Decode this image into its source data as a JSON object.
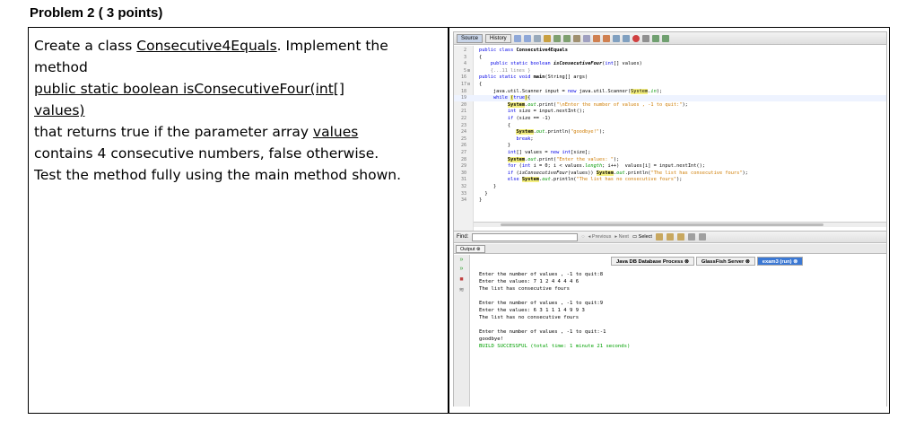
{
  "problem": {
    "title": "Problem 2 ( 3 points)",
    "line1_a": "Create a class ",
    "line1_class": "Consecutive4Equals",
    "line1_b": ". Implement the",
    "line2": "method",
    "line3": " public static boolean isConsecutiveFour(int[]",
    "line4": "values)",
    "line5_a": "that returns true if the parameter array ",
    "line5_b": "values",
    "line6": "contains 4 consecutive numbers, false otherwise.",
    "line7": "Test the method fully using the main method shown."
  },
  "ide": {
    "tabs": [
      "Source",
      "History"
    ],
    "find_label": "Find:",
    "find_previous": "Previous",
    "find_next": "Next",
    "find_select": "Select",
    "output_tab": "Output",
    "process_tabs": [
      "Java DB Database Process",
      "GlassFish Server",
      "exam3 (run)"
    ],
    "code_lines": [
      {
        "n": "2",
        "fold": "",
        "html": "<span class='kw'>public class</span> <span class='cls'>Consecutive4Equals</span>"
      },
      {
        "n": "3",
        "fold": "",
        "html": "{"
      },
      {
        "n": "4",
        "fold": "",
        "html": "    <span class='kw'>public static boolean</span> <span class='bold' style='font-style:italic'>isConsecutiveFour</span>(<span class='kw'>int</span>[] values)"
      },
      {
        "n": "5",
        "fold": "⊞",
        "html": "    <span class='cm'>{...11 lines }</span>"
      },
      {
        "n": "16",
        "fold": "",
        "html": "<span class='kw'>public static void</span> <span class='bold'>main</span>(String[] args)"
      },
      {
        "n": "17",
        "fold": "⊟",
        "html": "{"
      },
      {
        "n": "18",
        "fold": "",
        "html": "     java.util.Scanner input = <span class='kw'>new</span> java.util.Scanner(<span class='hl'>System</span>.<span class='fld'>in</span>);"
      },
      {
        "n": "19",
        "fold": "",
        "html": "     <span class='kw'>while</span> <span class='hl'>(</span><span class='kw'>true</span><span class='hl'>)</span>{",
        "row": true
      },
      {
        "n": "20",
        "fold": "",
        "html": "          <span class='hl bold'>System</span>.<span class='fld'>out</span>.print(<span class='str'>\"\\nEnter the number of values , -1 to quit:\"</span>);"
      },
      {
        "n": "21",
        "fold": "",
        "html": "          <span class='kw'>int</span> size = input.nextInt();"
      },
      {
        "n": "22",
        "fold": "",
        "html": "          <span class='kw'>if</span> (size == -1)"
      },
      {
        "n": "23",
        "fold": "",
        "html": "          {"
      },
      {
        "n": "24",
        "fold": "",
        "html": "             <span class='hl bold'>System</span>.<span class='fld'>out</span>.println(<span class='str'>\"goodbye!\"</span>);"
      },
      {
        "n": "25",
        "fold": "",
        "html": "             <span class='kw'>break</span>;"
      },
      {
        "n": "26",
        "fold": "",
        "html": "          }"
      },
      {
        "n": "27",
        "fold": "",
        "html": "          <span class='kw'>int</span>[] values = <span class='kw'>new int</span>[size];"
      },
      {
        "n": "28",
        "fold": "",
        "html": "          <span class='hl bold'>System</span>.<span class='fld'>out</span>.print(<span class='str'>\"Enter the values: \"</span>);"
      },
      {
        "n": "29",
        "fold": "",
        "html": "          <span class='kw'>for</span> (<span class='kw'>int</span> i = 0; i &lt; values.<span class='fld'>length</span>; i++)  values[i] = input.nextInt();"
      },
      {
        "n": "30",
        "fold": "",
        "html": "          <span class='kw'>if</span> (<span style='font-style:italic'>isConsecutiveFour</span>(values)) <span class='hl bold'>System</span>.<span class='fld'>out</span>.println(<span class='str'>\"The list has consecutive fours\"</span>);"
      },
      {
        "n": "31",
        "fold": "",
        "html": "          <span class='kw'>else</span> <span class='hl bold'>System</span>.<span class='fld'>out</span>.println(<span class='str'>\"The list has no consecutive fours\"</span>);"
      },
      {
        "n": "32",
        "fold": "",
        "html": "     }"
      },
      {
        "n": "33",
        "fold": "",
        "html": "  }"
      },
      {
        "n": "34",
        "fold": "",
        "html": "}"
      }
    ],
    "output_lines": [
      {
        "text": "Enter the number of values , -1 to quit:8",
        "success": false
      },
      {
        "text": "Enter the values: 7 1 2 4 4 4 4 6",
        "success": false
      },
      {
        "text": "The list has consecutive fours",
        "success": false
      },
      {
        "text": "",
        "success": false
      },
      {
        "text": "Enter the number of values , -1 to quit:9",
        "success": false
      },
      {
        "text": "Enter the values: 6 3 1 1 1 4 9 9 3",
        "success": false
      },
      {
        "text": "The list has no consecutive fours",
        "success": false
      },
      {
        "text": "",
        "success": false
      },
      {
        "text": "Enter the number of values , -1 to quit:-1",
        "success": false
      },
      {
        "text": "goodbye!",
        "success": false
      },
      {
        "text": "BUILD SUCCESSFUL (total time: 1 minute 21 seconds)",
        "success": true
      }
    ]
  }
}
